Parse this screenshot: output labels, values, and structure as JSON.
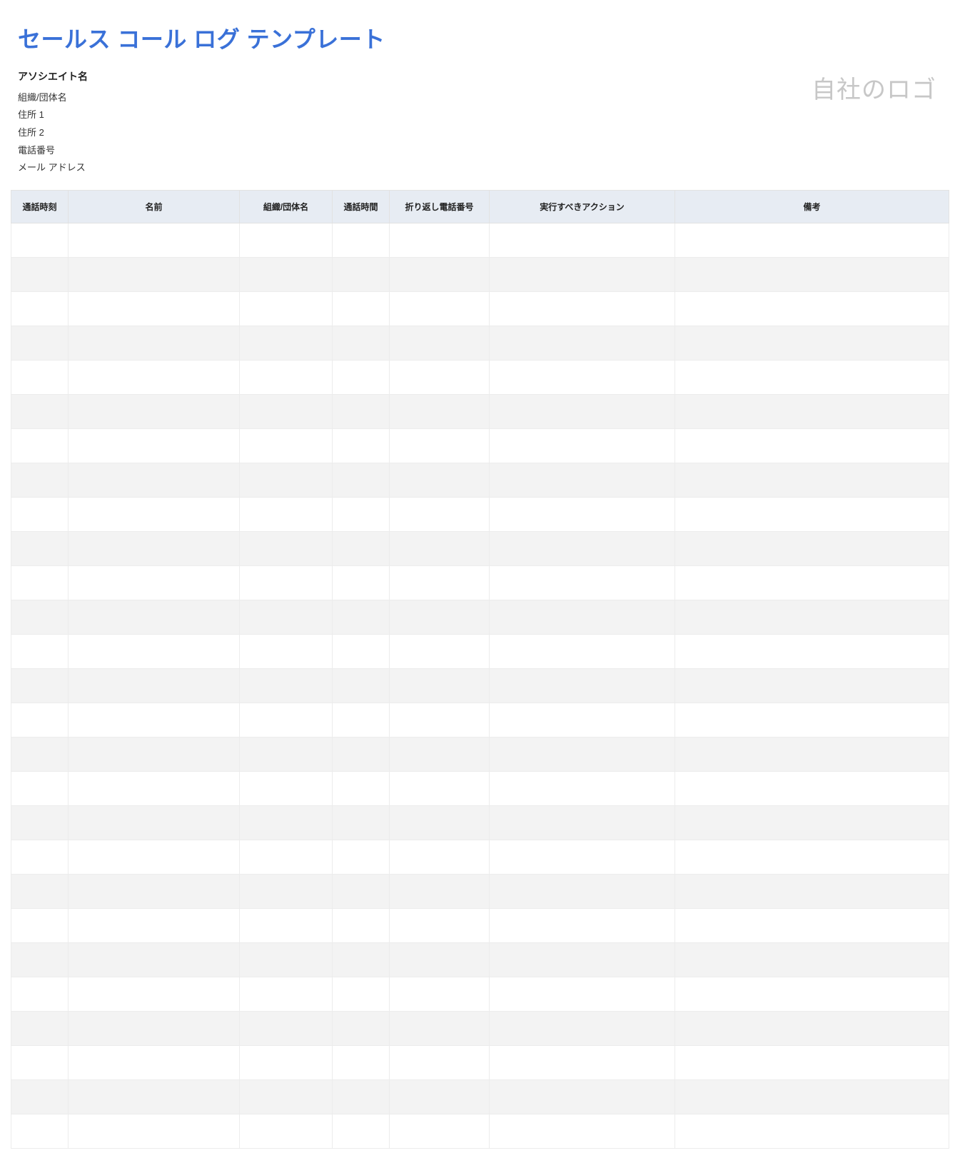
{
  "title": "セールス コール ログ テンプレート",
  "meta": {
    "associate_label": "アソシエイト名",
    "org_label": "組織/団体名",
    "address1_label": "住所 1",
    "address2_label": "住所 2",
    "phone_label": "電話番号",
    "email_label": "メール アドレス"
  },
  "logo_placeholder": "自社のロゴ",
  "table": {
    "headers": {
      "time": "通話時刻",
      "name": "名前",
      "org": "組織/団体名",
      "duration": "通話時間",
      "callback": "折り返し電話番号",
      "action": "実行すべきアクション",
      "notes": "備考"
    },
    "rows": [
      {
        "time": "",
        "name": "",
        "org": "",
        "duration": "",
        "callback": "",
        "action": "",
        "notes": ""
      },
      {
        "time": "",
        "name": "",
        "org": "",
        "duration": "",
        "callback": "",
        "action": "",
        "notes": ""
      },
      {
        "time": "",
        "name": "",
        "org": "",
        "duration": "",
        "callback": "",
        "action": "",
        "notes": ""
      },
      {
        "time": "",
        "name": "",
        "org": "",
        "duration": "",
        "callback": "",
        "action": "",
        "notes": ""
      },
      {
        "time": "",
        "name": "",
        "org": "",
        "duration": "",
        "callback": "",
        "action": "",
        "notes": ""
      },
      {
        "time": "",
        "name": "",
        "org": "",
        "duration": "",
        "callback": "",
        "action": "",
        "notes": ""
      },
      {
        "time": "",
        "name": "",
        "org": "",
        "duration": "",
        "callback": "",
        "action": "",
        "notes": ""
      },
      {
        "time": "",
        "name": "",
        "org": "",
        "duration": "",
        "callback": "",
        "action": "",
        "notes": ""
      },
      {
        "time": "",
        "name": "",
        "org": "",
        "duration": "",
        "callback": "",
        "action": "",
        "notes": ""
      },
      {
        "time": "",
        "name": "",
        "org": "",
        "duration": "",
        "callback": "",
        "action": "",
        "notes": ""
      },
      {
        "time": "",
        "name": "",
        "org": "",
        "duration": "",
        "callback": "",
        "action": "",
        "notes": ""
      },
      {
        "time": "",
        "name": "",
        "org": "",
        "duration": "",
        "callback": "",
        "action": "",
        "notes": ""
      },
      {
        "time": "",
        "name": "",
        "org": "",
        "duration": "",
        "callback": "",
        "action": "",
        "notes": ""
      },
      {
        "time": "",
        "name": "",
        "org": "",
        "duration": "",
        "callback": "",
        "action": "",
        "notes": ""
      },
      {
        "time": "",
        "name": "",
        "org": "",
        "duration": "",
        "callback": "",
        "action": "",
        "notes": ""
      },
      {
        "time": "",
        "name": "",
        "org": "",
        "duration": "",
        "callback": "",
        "action": "",
        "notes": ""
      },
      {
        "time": "",
        "name": "",
        "org": "",
        "duration": "",
        "callback": "",
        "action": "",
        "notes": ""
      },
      {
        "time": "",
        "name": "",
        "org": "",
        "duration": "",
        "callback": "",
        "action": "",
        "notes": ""
      },
      {
        "time": "",
        "name": "",
        "org": "",
        "duration": "",
        "callback": "",
        "action": "",
        "notes": ""
      },
      {
        "time": "",
        "name": "",
        "org": "",
        "duration": "",
        "callback": "",
        "action": "",
        "notes": ""
      },
      {
        "time": "",
        "name": "",
        "org": "",
        "duration": "",
        "callback": "",
        "action": "",
        "notes": ""
      },
      {
        "time": "",
        "name": "",
        "org": "",
        "duration": "",
        "callback": "",
        "action": "",
        "notes": ""
      },
      {
        "time": "",
        "name": "",
        "org": "",
        "duration": "",
        "callback": "",
        "action": "",
        "notes": ""
      },
      {
        "time": "",
        "name": "",
        "org": "",
        "duration": "",
        "callback": "",
        "action": "",
        "notes": ""
      },
      {
        "time": "",
        "name": "",
        "org": "",
        "duration": "",
        "callback": "",
        "action": "",
        "notes": ""
      },
      {
        "time": "",
        "name": "",
        "org": "",
        "duration": "",
        "callback": "",
        "action": "",
        "notes": ""
      },
      {
        "time": "",
        "name": "",
        "org": "",
        "duration": "",
        "callback": "",
        "action": "",
        "notes": ""
      }
    ]
  }
}
